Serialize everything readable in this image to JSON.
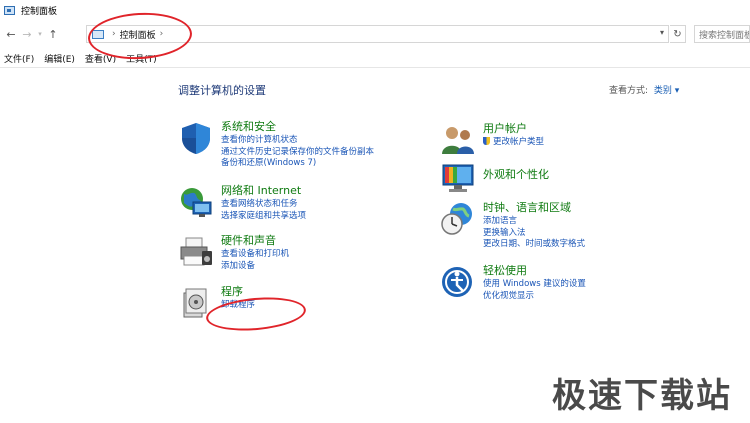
{
  "window": {
    "title": "控制面板"
  },
  "address": {
    "breadcrumb": "控制面板",
    "search_placeholder": "搜索控制面板"
  },
  "menu": [
    {
      "label": "文件(F)"
    },
    {
      "label": "编辑(E)"
    },
    {
      "label": "查看(V)"
    },
    {
      "label": "工具(T)"
    }
  ],
  "main": {
    "heading": "调整计算机的设置",
    "view_by_label": "查看方式:",
    "view_by_value": "类别"
  },
  "categories": {
    "system": {
      "title": "系统和安全",
      "links": [
        "查看你的计算机状态",
        "通过文件历史记录保存你的文件备份副本",
        "备份和还原(Windows 7)"
      ]
    },
    "network": {
      "title": "网络和 Internet",
      "links": [
        "查看网络状态和任务",
        "选择家庭组和共享选项"
      ]
    },
    "hardware": {
      "title": "硬件和声音",
      "links": [
        "查看设备和打印机",
        "添加设备"
      ]
    },
    "programs": {
      "title": "程序",
      "links": [
        "卸载程序"
      ]
    },
    "users": {
      "title": "用户帐户",
      "links": [
        "更改帐户类型"
      ]
    },
    "appearance": {
      "title": "外观和个性化",
      "links": []
    },
    "clock": {
      "title": "时钟、语言和区域",
      "links": [
        "添加语言",
        "更换输入法",
        "更改日期、时间或数字格式"
      ]
    },
    "access": {
      "title": "轻松使用",
      "links": [
        "使用 Windows 建议的设置",
        "优化视觉显示"
      ]
    }
  },
  "watermark": "极速下载站",
  "colors": {
    "category_title": "#0e7a10",
    "link": "#1a55b6",
    "heading": "#1e3a78",
    "annotation": "#e0242a"
  },
  "icons": [
    "control-panel-icon",
    "back-arrow-icon",
    "forward-arrow-icon",
    "up-arrow-icon",
    "refresh-icon",
    "shield-icon",
    "globe-network-icon",
    "printer-icon",
    "programs-icon",
    "users-icon",
    "monitor-icon",
    "clock-globe-icon",
    "accessibility-icon"
  ]
}
